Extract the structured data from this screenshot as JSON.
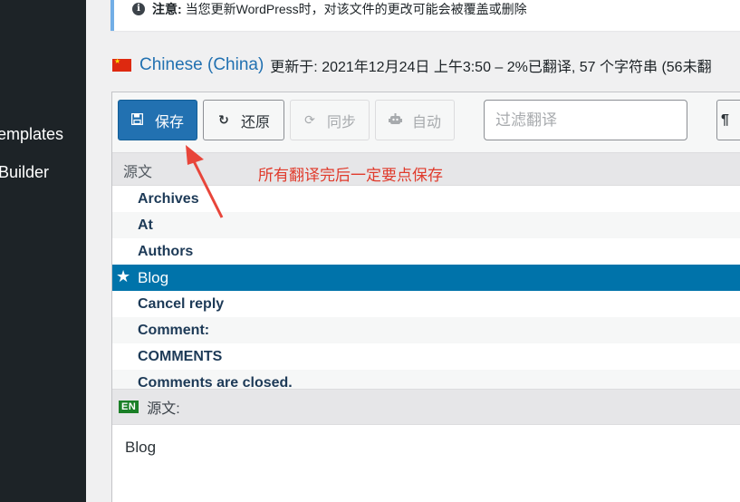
{
  "sidebar": {
    "items": [
      {
        "label": "emplates"
      },
      {
        "label": "Builder"
      }
    ]
  },
  "notice": {
    "icon": "info-icon",
    "label": "注意:",
    "text": "当您更新WordPress时，对该文件的更改可能会被覆盖或删除"
  },
  "heading": {
    "flag": "china-flag-icon",
    "language": "Chinese (China)",
    "updated": "更新于: 2021年12月24日 上午3:50 – 2%已翻译, 57 个字符串 (56未翻"
  },
  "toolbar": {
    "save_label": "保存",
    "revert_label": "还原",
    "sync_label": "同步",
    "auto_label": "自动",
    "filter_placeholder": "过滤翻译",
    "extra_label": "¶"
  },
  "list": {
    "header_label": "源文",
    "rows": [
      {
        "label": "Archives"
      },
      {
        "label": "At"
      },
      {
        "label": "Authors"
      },
      {
        "label": "Blog"
      },
      {
        "label": "Cancel reply"
      },
      {
        "label": "Comment:"
      },
      {
        "label": "COMMENTS"
      },
      {
        "label": "Comments are closed."
      }
    ]
  },
  "annotation": {
    "text": "所有翻译完后一定要点保存",
    "color": "#e03b2c"
  },
  "source": {
    "badge": "EN",
    "label": "源文:",
    "text": "Blog"
  },
  "colors": {
    "accent": "#2271b1",
    "selected_row": "#0073aa",
    "sidebar": "#1d2327"
  }
}
